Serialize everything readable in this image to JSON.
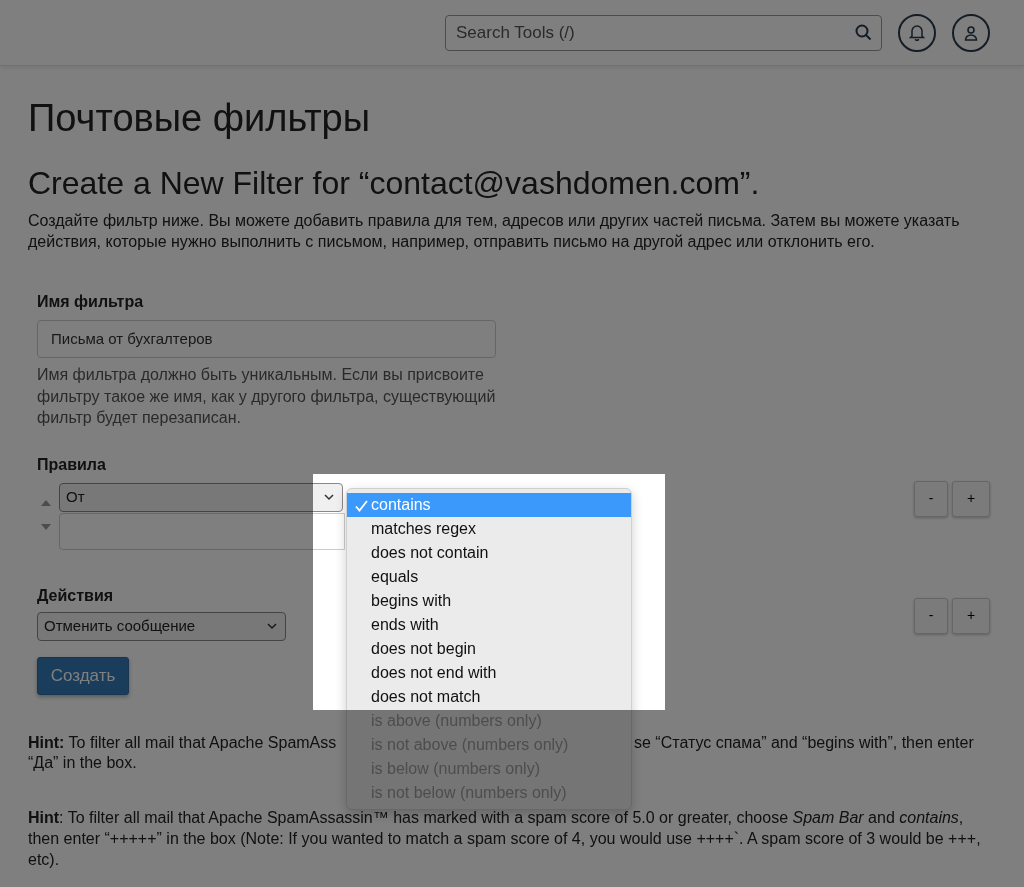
{
  "header": {
    "search": {
      "placeholder": "Search Tools (/)"
    }
  },
  "page_title": "Почтовые фильтры",
  "heading": "Create a New Filter for “contact@vashdomen.com”.",
  "intro": "Создайте фильтр ниже. Вы можете добавить правила для тем, адресов или других частей письма. Затем вы можете указать действия, которые нужно выполнить с письмом, например, отправить письмо на другой адрес или отклонить его.",
  "filter_name": {
    "label": "Имя фильтра",
    "value": "Письма от бухгалтеров",
    "help": "Имя фильтра должно быть уникальным. Если вы присвоите фильтру такое же имя, как у другого фильтра, существующий фильтр будет перезаписан."
  },
  "rules": {
    "label": "Правила",
    "part_select": "От",
    "buttons": [
      "-",
      "+"
    ]
  },
  "operator_menu": {
    "items": [
      {
        "label": "contains",
        "selected": true,
        "disabled": false
      },
      {
        "label": "matches regex",
        "selected": false,
        "disabled": false
      },
      {
        "label": "does not contain",
        "selected": false,
        "disabled": false
      },
      {
        "label": "equals",
        "selected": false,
        "disabled": false
      },
      {
        "label": "begins with",
        "selected": false,
        "disabled": false
      },
      {
        "label": "ends with",
        "selected": false,
        "disabled": false
      },
      {
        "label": "does not begin",
        "selected": false,
        "disabled": false
      },
      {
        "label": "does not end with",
        "selected": false,
        "disabled": false
      },
      {
        "label": "does not match",
        "selected": false,
        "disabled": false
      },
      {
        "label": "is above (numbers only)",
        "selected": false,
        "disabled": true
      },
      {
        "label": "is not above (numbers only)",
        "selected": false,
        "disabled": true
      },
      {
        "label": "is below (numbers only)",
        "selected": false,
        "disabled": true
      },
      {
        "label": "is not below (numbers only)",
        "selected": false,
        "disabled": true
      }
    ]
  },
  "actions": {
    "label": "Действия",
    "select": "Отменить сообщение",
    "buttons": [
      "-",
      "+"
    ]
  },
  "submit": "Создать",
  "hints": [
    {
      "lines": [
        "**Hint:** To filter all mail that Apache SpamAss",
        "se “Статус спама” and “begins with”, then enter",
        "“Да” in the box."
      ]
    },
    {
      "text": "**Hint**: To filter all mail that Apache SpamAssassin™ has marked with a spam score of 5.0 or greater, choose *Spam Bar* and *contains*, then enter “+++++” in the box (Note: If you wanted to match a spam score of 4, you would use ++++`. A spam score of 3 would be +++, etc)."
    }
  ]
}
